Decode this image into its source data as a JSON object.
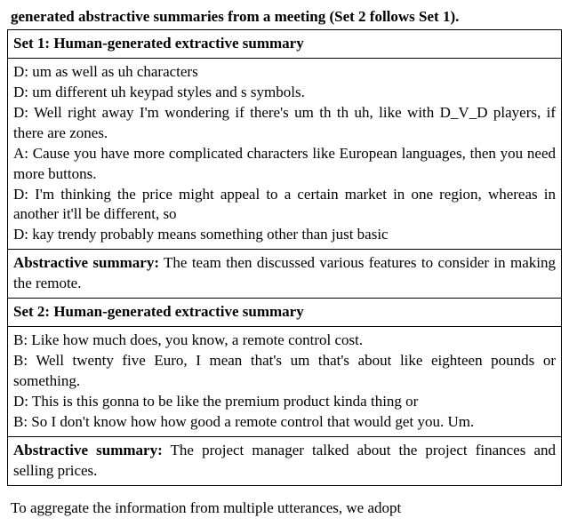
{
  "caption": "generated abstractive summaries from a meeting (Set 2 follows Set 1).",
  "set1": {
    "header": "Set 1: Human-generated extractive summary",
    "utterances": [
      "D: um as well as uh characters",
      "D: um different uh keypad styles and s symbols.",
      "D: Well right away I'm wondering if there's um th th uh, like with D_V_D players, if there are zones.",
      "A: Cause you have more complicated characters like European languages, then you need more buttons.",
      "D: I'm thinking the price might appeal to a certain market in one region, whereas in another it'll be different, so",
      "D: kay trendy probably means something other than just basic"
    ],
    "abs_label": "Abstractive summary:",
    "abs_text": " The team then discussed various features to consider in making the remote."
  },
  "set2": {
    "header": "Set 2: Human-generated extractive summary",
    "utterances": [
      "B: Like how much does, you know, a remote control cost.",
      "B: Well twenty five Euro, I mean that's um that's about like eighteen pounds or something.",
      "D: This is this gonna to be like the premium product kinda thing or",
      "B: So I don't know how how good a remote control that would get you. Um."
    ],
    "abs_label": "Abstractive summary:",
    "abs_text": " The project manager talked about the project finances and selling prices."
  },
  "footer": "To aggregate the information from multiple utterances, we adopt",
  "chart_data": {
    "type": "table",
    "title": "generated abstractive summaries from a meeting (Set 2 follows Set 1).",
    "sets": [
      {
        "name": "Set 1: Human-generated extractive summary",
        "rows": [
          "D: um as well as uh characters",
          "D: um different uh keypad styles and s symbols.",
          "D: Well right away I'm wondering if there's um th th uh, like with D_V_D players, if there are zones.",
          "A: Cause you have more complicated characters like European languages, then you need more buttons.",
          "D: I'm thinking the price might appeal to a certain market in one region, whereas in another it'll be different, so",
          "D: kay trendy probably means something other than just basic"
        ],
        "abstractive_summary": "The team then discussed various features to consider in making the remote."
      },
      {
        "name": "Set 2: Human-generated extractive summary",
        "rows": [
          "B: Like how much does, you know, a remote control cost.",
          "B: Well twenty five Euro, I mean that's um that's about like eighteen pounds or something.",
          "D: This is this gonna to be like the premium product kinda thing or",
          "B: So I don't know how how good a remote control that would get you. Um."
        ],
        "abstractive_summary": "The project manager talked about the project finances and selling prices."
      }
    ]
  }
}
